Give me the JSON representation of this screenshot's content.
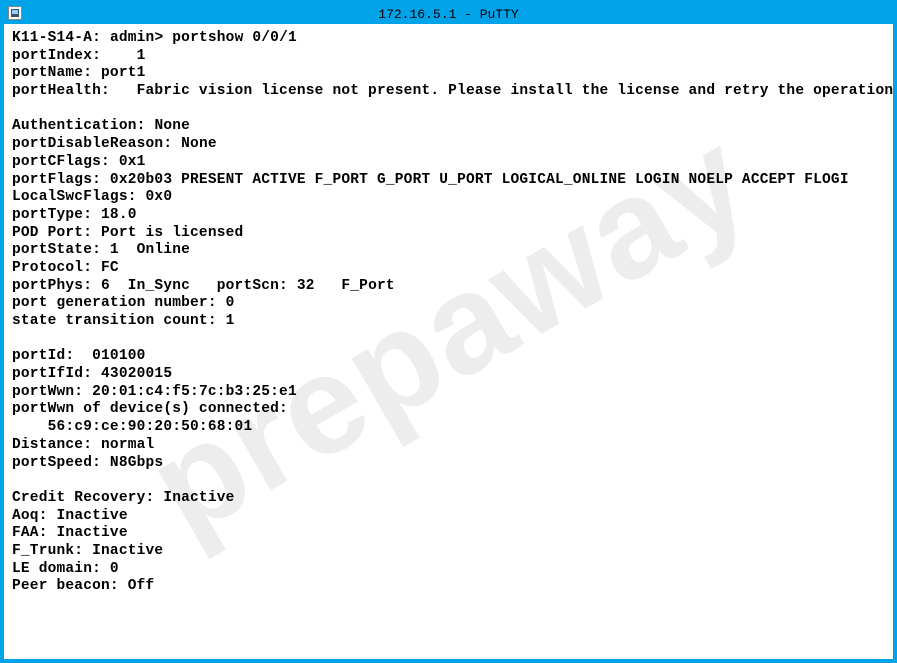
{
  "titlebar": {
    "title": "172.16.5.1 - PuTTY"
  },
  "prompt": {
    "host": "K11-S14-A",
    "user": "admin",
    "command": "portshow 0/0/1"
  },
  "output": {
    "portIndex": "1",
    "portName": "port1",
    "portHealth": "Fabric vision license not present. Please install the license and retry the operation.",
    "authentication": "None",
    "portDisableReason": "None",
    "portCFlags": "0x1",
    "portFlags": "0x20b03 PRESENT ACTIVE F_PORT G_PORT U_PORT LOGICAL_ONLINE LOGIN NOELP ACCEPT FLOGI",
    "localSwcFlags": "0x0",
    "portType": "18.0",
    "podPort": "Port is licensed",
    "portState": "1  Online",
    "protocol": "FC",
    "portPhys": "6  In_Sync",
    "portScn": "32   F_Port",
    "portGenerationNumber": "0",
    "stateTransitionCount": "1",
    "portId": "010100",
    "portIfId": "43020015",
    "portWwn": "20:01:c4:f5:7c:b3:25:e1",
    "connectedDeviceWwn": "56:c9:ce:90:20:50:68:01",
    "distance": "normal",
    "portSpeed": "N8Gbps",
    "creditRecovery": "Inactive",
    "aoq": "Inactive",
    "faa": "Inactive",
    "fTrunk": "Inactive",
    "leDomain": "0",
    "peerBeacon": "Off"
  },
  "watermark": "prepaway"
}
